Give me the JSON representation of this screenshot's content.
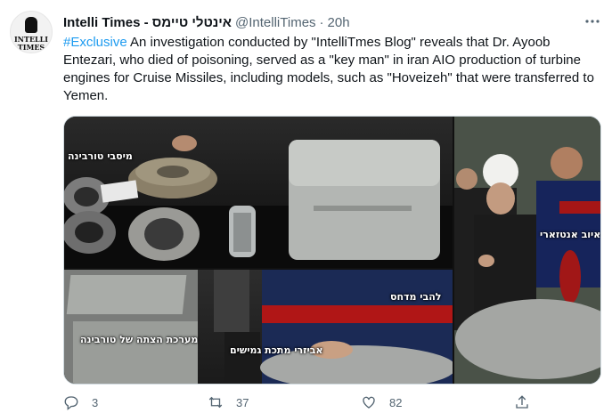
{
  "tweet": {
    "author_name": "Intelli Times - אינטלי טיימס",
    "handle": "@IntelliTimes",
    "separator": "·",
    "time": "20h",
    "hashtag": "#Exclusive",
    "body": " An investigation conducted by \"IntelliTmes Blog\" reveals that Dr. Ayoob Entezari, who died of poisoning, served as a \"key man\" in iran AIO production of turbine engines for Cruise Missiles, including models, such as \"Hoveizeh\" that were transferred to Yemen.",
    "avatar_logo_line1": "INTELLI",
    "avatar_logo_line2": "TIMES"
  },
  "media": {
    "label_turbine_parts": "מיסבי טורבינה",
    "label_turbine_ignition": "מערכת הצתה של טורבינה",
    "label_damper_accessories": "אביזרי מתכת גמישים",
    "label_compressor_blades": "להבי מדחס",
    "label_person_name": "איוב אנטזארי"
  },
  "actions": {
    "reply_count": "3",
    "retweet_count": "37",
    "like_count": "82"
  },
  "icons": [
    "more-options-icon",
    "reply-icon",
    "retweet-icon",
    "like-icon",
    "share-icon"
  ],
  "colors": {
    "link": "#1d9bf0",
    "muted": "#536471",
    "text": "#0f1419"
  }
}
